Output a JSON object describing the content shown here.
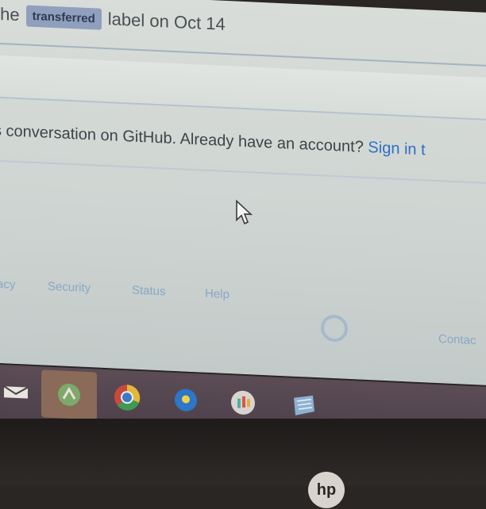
{
  "timeline": {
    "prefix": "the",
    "label_name": "transferred",
    "suffix": "label on Oct 14"
  },
  "signin_prompt": {
    "text": "s conversation on GitHub. Already have an account?",
    "link": "Sign in t"
  },
  "footer": {
    "links": [
      "acy",
      "Security",
      "Status",
      "Help"
    ],
    "contact": "Contac",
    "logo_icon": "github-octocat-icon"
  },
  "taskbar": {
    "items": [
      "start-icon",
      "android-studio-icon",
      "chrome-icon",
      "blue-app-icon",
      "slack-icon",
      "notepad-icon"
    ]
  },
  "device": {
    "brand_logo": "hp"
  },
  "colors": {
    "link": "#2f6fc7",
    "label_bg": "#8f9fbd",
    "taskbar": "#5b4c55"
  }
}
